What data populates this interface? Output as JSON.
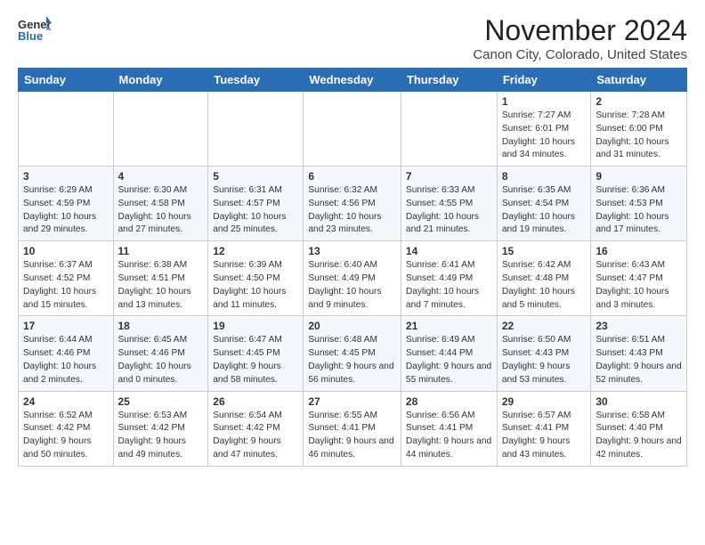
{
  "header": {
    "logo_line1": "General",
    "logo_line2": "Blue",
    "title": "November 2024",
    "subtitle": "Canon City, Colorado, United States"
  },
  "weekdays": [
    "Sunday",
    "Monday",
    "Tuesday",
    "Wednesday",
    "Thursday",
    "Friday",
    "Saturday"
  ],
  "weeks": [
    [
      {
        "day": "",
        "content": ""
      },
      {
        "day": "",
        "content": ""
      },
      {
        "day": "",
        "content": ""
      },
      {
        "day": "",
        "content": ""
      },
      {
        "day": "",
        "content": ""
      },
      {
        "day": "1",
        "content": "Sunrise: 7:27 AM\nSunset: 6:01 PM\nDaylight: 10 hours and 34 minutes."
      },
      {
        "day": "2",
        "content": "Sunrise: 7:28 AM\nSunset: 6:00 PM\nDaylight: 10 hours and 31 minutes."
      }
    ],
    [
      {
        "day": "3",
        "content": "Sunrise: 6:29 AM\nSunset: 4:59 PM\nDaylight: 10 hours and 29 minutes."
      },
      {
        "day": "4",
        "content": "Sunrise: 6:30 AM\nSunset: 4:58 PM\nDaylight: 10 hours and 27 minutes."
      },
      {
        "day": "5",
        "content": "Sunrise: 6:31 AM\nSunset: 4:57 PM\nDaylight: 10 hours and 25 minutes."
      },
      {
        "day": "6",
        "content": "Sunrise: 6:32 AM\nSunset: 4:56 PM\nDaylight: 10 hours and 23 minutes."
      },
      {
        "day": "7",
        "content": "Sunrise: 6:33 AM\nSunset: 4:55 PM\nDaylight: 10 hours and 21 minutes."
      },
      {
        "day": "8",
        "content": "Sunrise: 6:35 AM\nSunset: 4:54 PM\nDaylight: 10 hours and 19 minutes."
      },
      {
        "day": "9",
        "content": "Sunrise: 6:36 AM\nSunset: 4:53 PM\nDaylight: 10 hours and 17 minutes."
      }
    ],
    [
      {
        "day": "10",
        "content": "Sunrise: 6:37 AM\nSunset: 4:52 PM\nDaylight: 10 hours and 15 minutes."
      },
      {
        "day": "11",
        "content": "Sunrise: 6:38 AM\nSunset: 4:51 PM\nDaylight: 10 hours and 13 minutes."
      },
      {
        "day": "12",
        "content": "Sunrise: 6:39 AM\nSunset: 4:50 PM\nDaylight: 10 hours and 11 minutes."
      },
      {
        "day": "13",
        "content": "Sunrise: 6:40 AM\nSunset: 4:49 PM\nDaylight: 10 hours and 9 minutes."
      },
      {
        "day": "14",
        "content": "Sunrise: 6:41 AM\nSunset: 4:49 PM\nDaylight: 10 hours and 7 minutes."
      },
      {
        "day": "15",
        "content": "Sunrise: 6:42 AM\nSunset: 4:48 PM\nDaylight: 10 hours and 5 minutes."
      },
      {
        "day": "16",
        "content": "Sunrise: 6:43 AM\nSunset: 4:47 PM\nDaylight: 10 hours and 3 minutes."
      }
    ],
    [
      {
        "day": "17",
        "content": "Sunrise: 6:44 AM\nSunset: 4:46 PM\nDaylight: 10 hours and 2 minutes."
      },
      {
        "day": "18",
        "content": "Sunrise: 6:45 AM\nSunset: 4:46 PM\nDaylight: 10 hours and 0 minutes."
      },
      {
        "day": "19",
        "content": "Sunrise: 6:47 AM\nSunset: 4:45 PM\nDaylight: 9 hours and 58 minutes."
      },
      {
        "day": "20",
        "content": "Sunrise: 6:48 AM\nSunset: 4:45 PM\nDaylight: 9 hours and 56 minutes."
      },
      {
        "day": "21",
        "content": "Sunrise: 6:49 AM\nSunset: 4:44 PM\nDaylight: 9 hours and 55 minutes."
      },
      {
        "day": "22",
        "content": "Sunrise: 6:50 AM\nSunset: 4:43 PM\nDaylight: 9 hours and 53 minutes."
      },
      {
        "day": "23",
        "content": "Sunrise: 6:51 AM\nSunset: 4:43 PM\nDaylight: 9 hours and 52 minutes."
      }
    ],
    [
      {
        "day": "24",
        "content": "Sunrise: 6:52 AM\nSunset: 4:42 PM\nDaylight: 9 hours and 50 minutes."
      },
      {
        "day": "25",
        "content": "Sunrise: 6:53 AM\nSunset: 4:42 PM\nDaylight: 9 hours and 49 minutes."
      },
      {
        "day": "26",
        "content": "Sunrise: 6:54 AM\nSunset: 4:42 PM\nDaylight: 9 hours and 47 minutes."
      },
      {
        "day": "27",
        "content": "Sunrise: 6:55 AM\nSunset: 4:41 PM\nDaylight: 9 hours and 46 minutes."
      },
      {
        "day": "28",
        "content": "Sunrise: 6:56 AM\nSunset: 4:41 PM\nDaylight: 9 hours and 44 minutes."
      },
      {
        "day": "29",
        "content": "Sunrise: 6:57 AM\nSunset: 4:41 PM\nDaylight: 9 hours and 43 minutes."
      },
      {
        "day": "30",
        "content": "Sunrise: 6:58 AM\nSunset: 4:40 PM\nDaylight: 9 hours and 42 minutes."
      }
    ]
  ]
}
